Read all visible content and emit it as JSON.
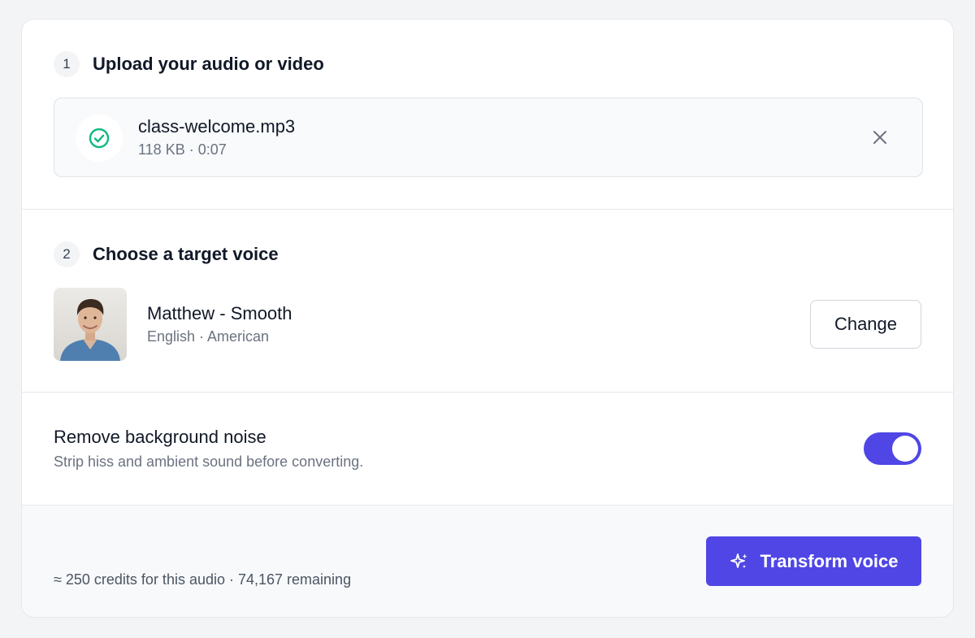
{
  "upload": {
    "step_number": "1",
    "title": "Upload your audio or video",
    "file": {
      "name": "class-welcome.mp3",
      "meta": "118 KB · 0:07",
      "status_icon": "check-circle-icon",
      "remove_icon": "close-icon"
    }
  },
  "voice": {
    "step_number": "2",
    "title": "Choose a target voice",
    "name": "Matthew - Smooth",
    "meta": "English · American",
    "change_label": "Change"
  },
  "noise": {
    "title": "Remove background noise",
    "description": "Strip hiss and ambient sound before converting.",
    "enabled": true
  },
  "footer": {
    "credits_text": "≈ 250 credits for this audio · 74,167 remaining",
    "transform_label": "Transform voice",
    "transform_icon": "sparkle-icon"
  },
  "colors": {
    "accent": "#4f46e5",
    "success": "#10b981",
    "muted_text": "#6b7280"
  }
}
